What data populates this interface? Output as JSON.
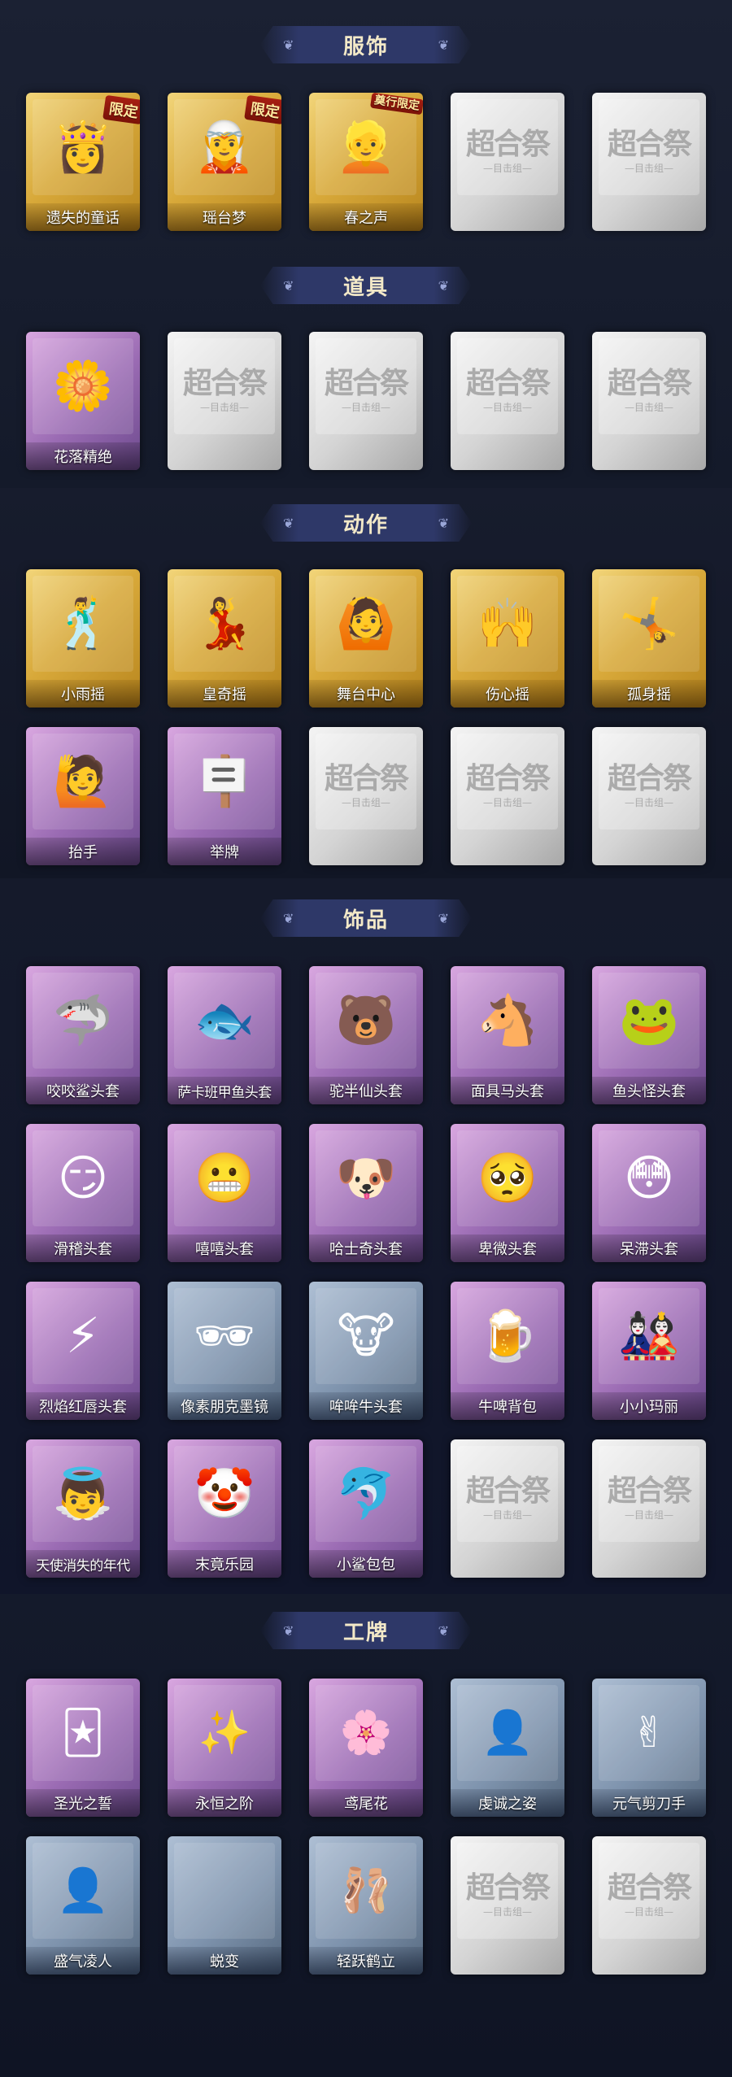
{
  "sections": [
    {
      "title": "服饰",
      "items": [
        {
          "label": "遗失的童话",
          "badge": "限定",
          "icon": "princess-avatar-icon"
        },
        {
          "label": "瑶台梦",
          "badge": "限定",
          "icon": "silver-hair-avatar-icon"
        },
        {
          "label": "春之声",
          "badge": "奠行限定",
          "icon": "blonde-avatar-icon"
        },
        {
          "label": "",
          "watermark": "超合祭",
          "watermark_sub": "—目击组—"
        },
        {
          "label": "",
          "watermark": "超合祭",
          "watermark_sub": "—目击组—"
        }
      ]
    },
    {
      "title": "道具",
      "items": [
        {
          "label": "花落精绝",
          "icon": "flower-necklace-icon"
        },
        {
          "label": "",
          "watermark": "超合祭",
          "watermark_sub": "—目击组—"
        },
        {
          "label": "",
          "watermark": "超合祭",
          "watermark_sub": "—目击组—"
        },
        {
          "label": "",
          "watermark": "超合祭",
          "watermark_sub": "—目击组—"
        },
        {
          "label": "",
          "watermark": "超合祭",
          "watermark_sub": "—目击组—"
        }
      ]
    },
    {
      "title": "动作",
      "items": [
        {
          "label": "小雨摇",
          "icon": "dance-pose-icon"
        },
        {
          "label": "皇奇摇",
          "icon": "dance-pose-icon"
        },
        {
          "label": "舞台中心",
          "icon": "dance-pose-icon"
        },
        {
          "label": "伤心摇",
          "icon": "heart-hands-pose-icon"
        },
        {
          "label": "孤身摇",
          "icon": "dance-pose-icon"
        },
        {
          "label": "抬手",
          "icon": "raise-hand-pose-icon"
        },
        {
          "label": "举牌",
          "icon": "hold-sign-pose-icon"
        },
        {
          "label": "",
          "watermark": "超合祭",
          "watermark_sub": "—目击组—"
        },
        {
          "label": "",
          "watermark": "超合祭",
          "watermark_sub": "—目击组—"
        },
        {
          "label": "",
          "watermark": "超合祭",
          "watermark_sub": "—目击组—"
        }
      ]
    },
    {
      "title": "饰品",
      "items": [
        {
          "label": "咬咬鲨头套",
          "icon": "shark-head-icon"
        },
        {
          "label": "萨卡班甲鱼头套",
          "icon": "fish-head-icon"
        },
        {
          "label": "驼半仙头套",
          "icon": "bear-head-icon"
        },
        {
          "label": "面具马头套",
          "icon": "horse-head-icon"
        },
        {
          "label": "鱼头怪头套",
          "icon": "frog-fish-head-icon"
        },
        {
          "label": "滑稽头套",
          "icon": "smug-emoji-head-icon"
        },
        {
          "label": "嘻嘻头套",
          "icon": "grin-emoji-head-icon"
        },
        {
          "label": "哈士奇头套",
          "icon": "husky-head-icon"
        },
        {
          "label": "卑微头套",
          "icon": "pleading-emoji-head-icon"
        },
        {
          "label": "呆滞头套",
          "icon": "dazed-emoji-head-icon"
        },
        {
          "label": "烈焰红唇头套",
          "icon": "pikachu-head-icon"
        },
        {
          "label": "像素朋克墨镜",
          "icon": "pixel-sunglasses-icon"
        },
        {
          "label": "哞哞牛头套",
          "icon": "cow-head-icon"
        },
        {
          "label": "牛啤背包",
          "icon": "cow-barrel-backpack-icon"
        },
        {
          "label": "小小玛丽",
          "icon": "doll-pendant-icon"
        },
        {
          "label": "天使消失的年代",
          "icon": "angel-pendant-icon"
        },
        {
          "label": "末竟乐园",
          "icon": "clown-pendant-icon"
        },
        {
          "label": "小鲨包包",
          "icon": "shark-bag-icon"
        },
        {
          "label": "",
          "watermark": "超合祭",
          "watermark_sub": "—目击组—"
        },
        {
          "label": "",
          "watermark": "超合祭",
          "watermark_sub": "—目击组—"
        }
      ]
    },
    {
      "title": "工牌",
      "items": [
        {
          "label": "圣光之誓",
          "icon": "golden-card-icon"
        },
        {
          "label": "永恒之阶",
          "icon": "glowing-card-icon"
        },
        {
          "label": "鸢尾花",
          "icon": "purple-card-icon"
        },
        {
          "label": "虔诚之姿",
          "icon": "silhouette-card-icon"
        },
        {
          "label": "元气剪刀手",
          "icon": "silhouette-card-icon"
        },
        {
          "label": "盛气凌人",
          "icon": "silhouette-card-icon"
        },
        {
          "label": "蜕变",
          "icon": "blank-card-icon"
        },
        {
          "label": "轻跃鹤立",
          "icon": "silhouette-card-icon"
        },
        {
          "label": "",
          "watermark": "超合祭",
          "watermark_sub": "—目击组—"
        },
        {
          "label": "",
          "watermark": "超合祭",
          "watermark_sub": "—目击组—"
        }
      ]
    }
  ],
  "colors": {
    "background": "#161b2b",
    "header_bg": "#2e3868",
    "header_text": "#f3e9c8",
    "badge": "#a82012"
  }
}
